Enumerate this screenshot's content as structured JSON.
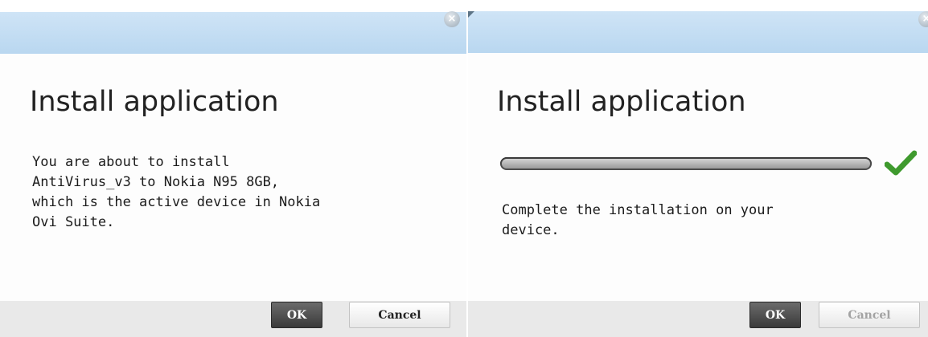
{
  "dialogs": [
    {
      "title": "Install application",
      "close_icon": "close-icon",
      "message": "You are about to install\nAntiVirus_v3 to Nokia N95 8GB,\nwhich is the active device in Nokia\nOvi Suite.",
      "buttons": {
        "ok": "OK",
        "cancel": "Cancel"
      }
    },
    {
      "title": "Install application",
      "close_icon": "close-icon",
      "progress": 1.0,
      "status_icon": "checkmark-icon",
      "message": "Complete the installation on your\ndevice.",
      "buttons": {
        "ok": "OK",
        "cancel": "Cancel",
        "cancel_enabled": false
      }
    }
  ],
  "colors": {
    "titlebar": "#c4ddf3",
    "footer": "#e9e9e9",
    "ok_button": "#4a4a4a",
    "checkmark": "#3f9a2e",
    "progress_fill": "#b8b8b8"
  }
}
